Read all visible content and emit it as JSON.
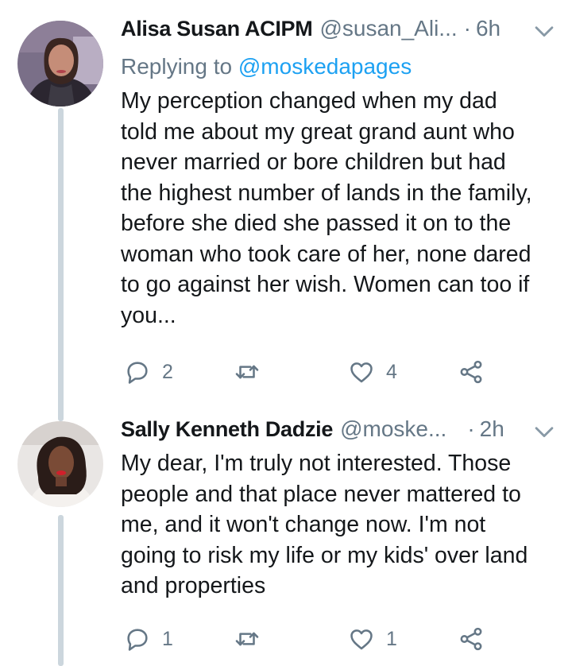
{
  "tweets": [
    {
      "name": "Alisa Susan ACIPM",
      "handle": "@susan_Ali...",
      "time": "6h",
      "replying_label": "Replying to",
      "replying_to": "@moskedapages",
      "text": "My perception changed when my dad\ntold me about my great grand aunt who\nnever married or bore children but had\nthe highest number of lands in the family,\nbefore she died she passed it on to the\nwoman who took care of her, none dared\nto go against her wish. Women can too if\nyou...",
      "reply_count": "2",
      "retweet_count": "",
      "like_count": "4"
    },
    {
      "name": "Sally Kenneth Dadzie",
      "handle": "@moske...",
      "time": "2h",
      "text": "My dear, I'm truly not interested. Those\npeople and that place never mattered to\nme, and it won't change now. I'm not\ngoing to risk my life or my kids' over land\nand properties",
      "reply_count": "1",
      "retweet_count": "",
      "like_count": "1"
    }
  ],
  "colors": {
    "text": "#14171a",
    "secondary": "#657786",
    "link": "#1da1f2",
    "thread_line": "#ccd6dd"
  },
  "icons": [
    "chevron-down-icon",
    "reply-icon",
    "retweet-icon",
    "like-icon",
    "share-icon"
  ]
}
